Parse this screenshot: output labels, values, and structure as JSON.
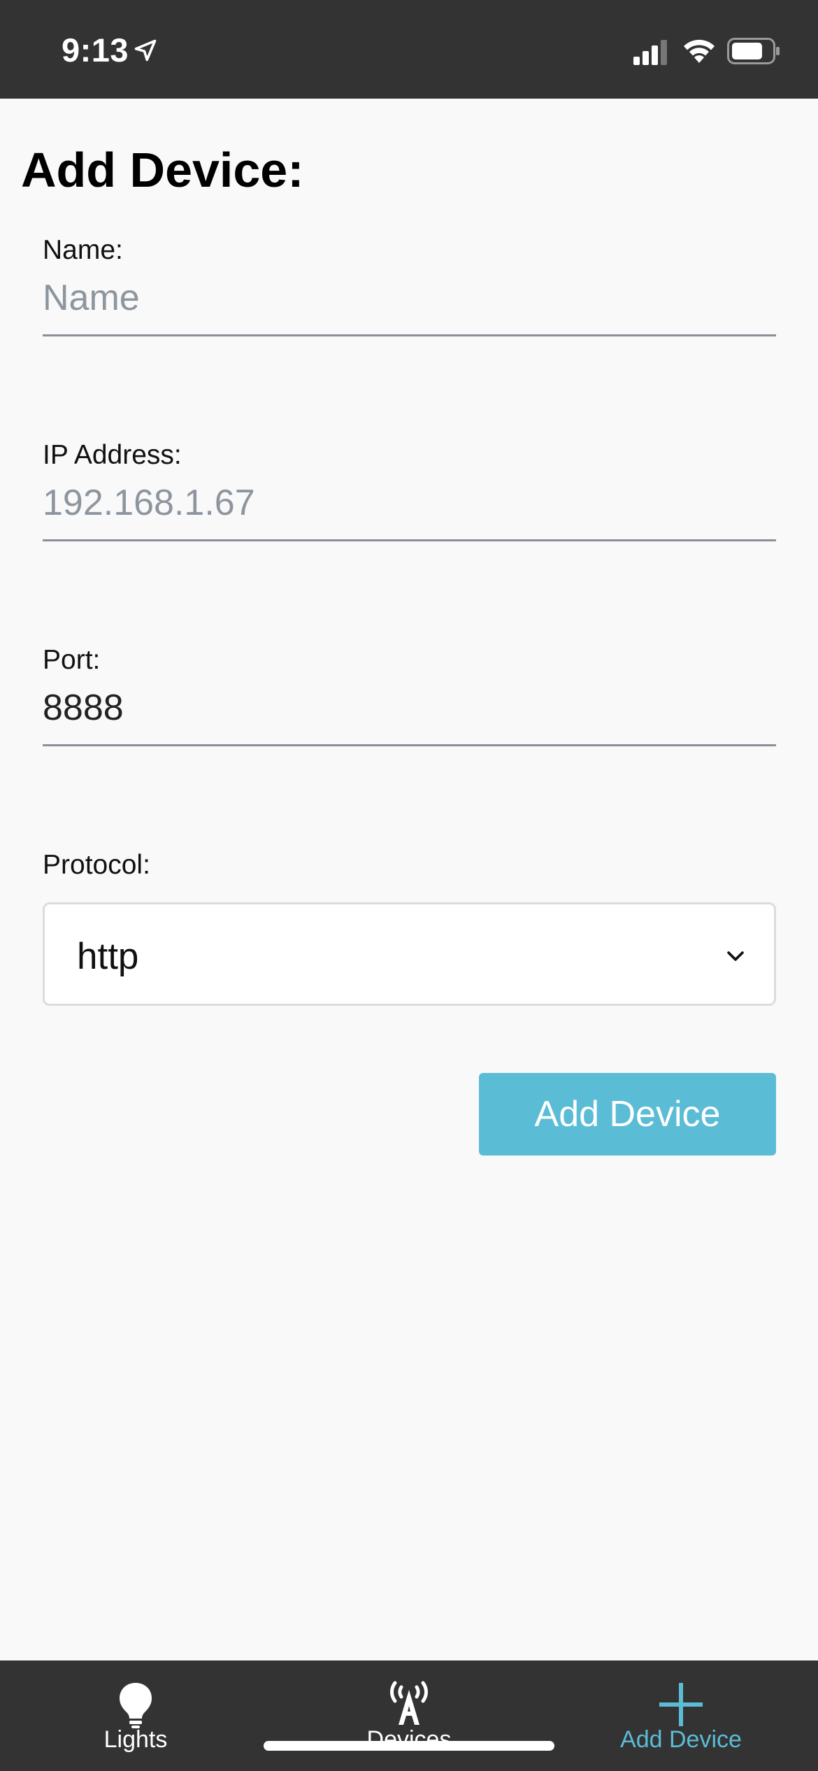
{
  "status_bar": {
    "time": "9:13",
    "icons": [
      "location-arrow-icon",
      "cellular-signal-icon",
      "wifi-icon",
      "battery-icon"
    ]
  },
  "page": {
    "title": "Add Device:"
  },
  "form": {
    "name": {
      "label": "Name:",
      "value": "",
      "placeholder": "Name"
    },
    "ip": {
      "label": "IP Address:",
      "value": "",
      "placeholder": "192.168.1.67"
    },
    "port": {
      "label": "Port:",
      "value": "8888",
      "placeholder": ""
    },
    "protocol": {
      "label": "Protocol:",
      "selected": "http"
    },
    "submit_label": "Add Device"
  },
  "tab_bar": {
    "tabs": [
      {
        "label": "Lights",
        "icon": "lightbulb-icon",
        "active": false
      },
      {
        "label": "Devices",
        "icon": "antenna-icon",
        "active": false
      },
      {
        "label": "Add Device",
        "icon": "plus-icon",
        "active": true
      }
    ]
  },
  "colors": {
    "status_bar_bg": "#333333",
    "page_bg": "#f9f9f9",
    "accent": "#5bbcd6",
    "placeholder": "#8d959e",
    "underline": "#8e8e98"
  }
}
